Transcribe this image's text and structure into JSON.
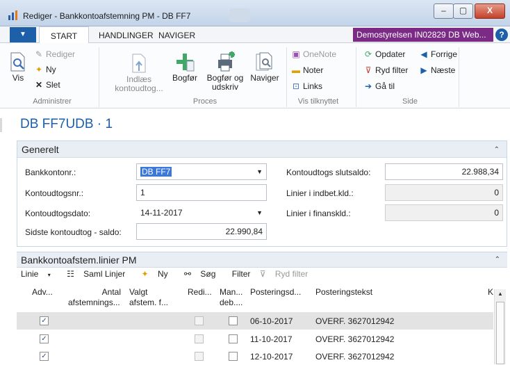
{
  "window": {
    "title": "Rediger - Bankkontoafstemning PM - DB FF7",
    "close": "X",
    "minimize": "–",
    "maximize": "▢"
  },
  "tabs": {
    "start": "START",
    "handlinger": "HANDLINGER",
    "naviger": "NAVIGER"
  },
  "company": "Demostyrelsen IN02829 DB Web...",
  "help": "?",
  "ribbon": {
    "vis": "Vis",
    "rediger": "Rediger",
    "ny": "Ny",
    "slet": "Slet",
    "administrer": "Administrer",
    "indlaes_1": "Indlæs",
    "indlaes_2": "kontoudtog...",
    "bogfor": "Bogfør",
    "bogfor_udskriv_1": "Bogfør og",
    "bogfor_udskriv_2": "udskriv",
    "naviger": "Naviger",
    "proces": "Proces",
    "onenote": "OneNote",
    "noter": "Noter",
    "links": "Links",
    "vis_tilknyttet": "Vis tilknyttet",
    "opdater": "Opdater",
    "ryd_filter": "Ryd filter",
    "gaa_til": "Gå til",
    "forrige": "Forrige",
    "naeste": "Næste",
    "side": "Side"
  },
  "page_title": "DB FF7UDB · 1",
  "general": {
    "header": "Generelt",
    "bank_label": "Bankkontonr.:",
    "bank_value": "DB FF7",
    "statement_no_label": "Kontoudtogsnr.:",
    "statement_no_value": "1",
    "statement_date_label": "Kontoudtogsdato:",
    "statement_date_value": "14-11-2017",
    "last_balance_label": "Sidste kontoudtog - saldo:",
    "last_balance_value": "22.990,84",
    "ending_balance_label": "Kontoudtogs slutsaldo:",
    "ending_balance_value": "22.988,34",
    "lines_deposit_label": "Linier i indbet.kld.:",
    "lines_deposit_value": "0",
    "lines_finance_label": "Linier i finanskld.:",
    "lines_finance_value": "0"
  },
  "lines": {
    "header": "Bankkontoafstem.linier PM",
    "toolbar": {
      "linie": "Linie",
      "saml": "Saml Linjer",
      "ny": "Ny",
      "sog": "Søg",
      "filter": "Filter",
      "ryd": "Ryd filter"
    },
    "columns": {
      "adv": "Adv...",
      "antal_1": "Antal",
      "antal_2": "afstemnings...",
      "valgt_1": "Valgt",
      "valgt_2": "afstem. f...",
      "redi": "Redi...",
      "man_1": "Man...",
      "man_2": "deb....",
      "posteringsdato": "Posteringsd...",
      "posteringstekst": "Posteringstekst",
      "k": "K"
    },
    "rows": [
      {
        "date": "06-10-2017",
        "text": "OVERF. 3627012942",
        "adv": "✓"
      },
      {
        "date": "11-10-2017",
        "text": "OVERF. 3627012942",
        "adv": "✓"
      },
      {
        "date": "12-10-2017",
        "text": "OVERF. 3627012942",
        "adv": "✓"
      }
    ]
  }
}
